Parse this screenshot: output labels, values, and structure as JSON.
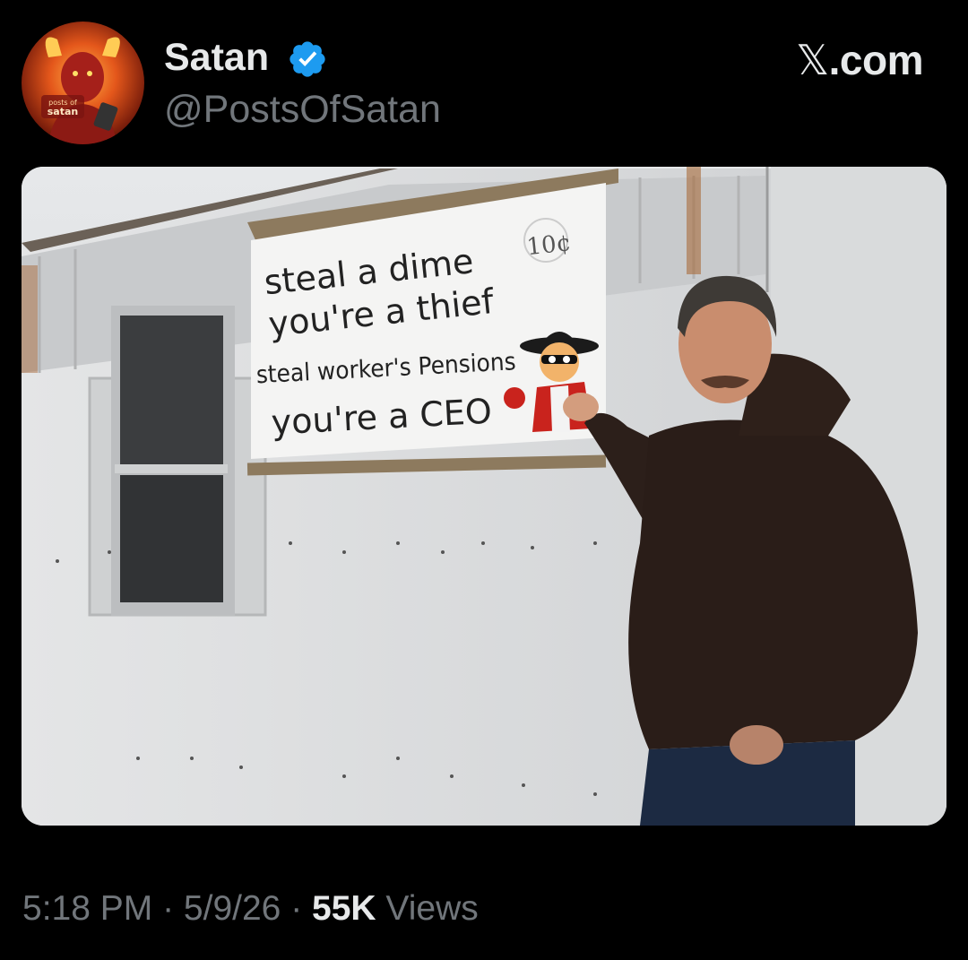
{
  "author": {
    "display_name": "Satan",
    "handle": "@PostsOfSatan",
    "avatar_text": [
      "posts of",
      "satan"
    ],
    "verified": true
  },
  "brand": {
    "x_glyph": "𝕏",
    "suffix": ".com"
  },
  "media": {
    "sign_lines": [
      "steal a dime",
      "you're a thief",
      "steal worker's Pensions",
      "you're a CEO"
    ],
    "price_tag": "10¢"
  },
  "post_meta": {
    "time": "5:18 PM",
    "separator": " · ",
    "date": "5/9/26",
    "views_count": "55K",
    "views_label": "Views"
  },
  "colors": {
    "background": "#000000",
    "primary_text": "#e7e9ea",
    "secondary_text": "#71767b",
    "verified_blue": "#1d9bf0"
  },
  "icons": [
    "avatar-image",
    "verified-badge-icon",
    "x-logo-icon"
  ]
}
